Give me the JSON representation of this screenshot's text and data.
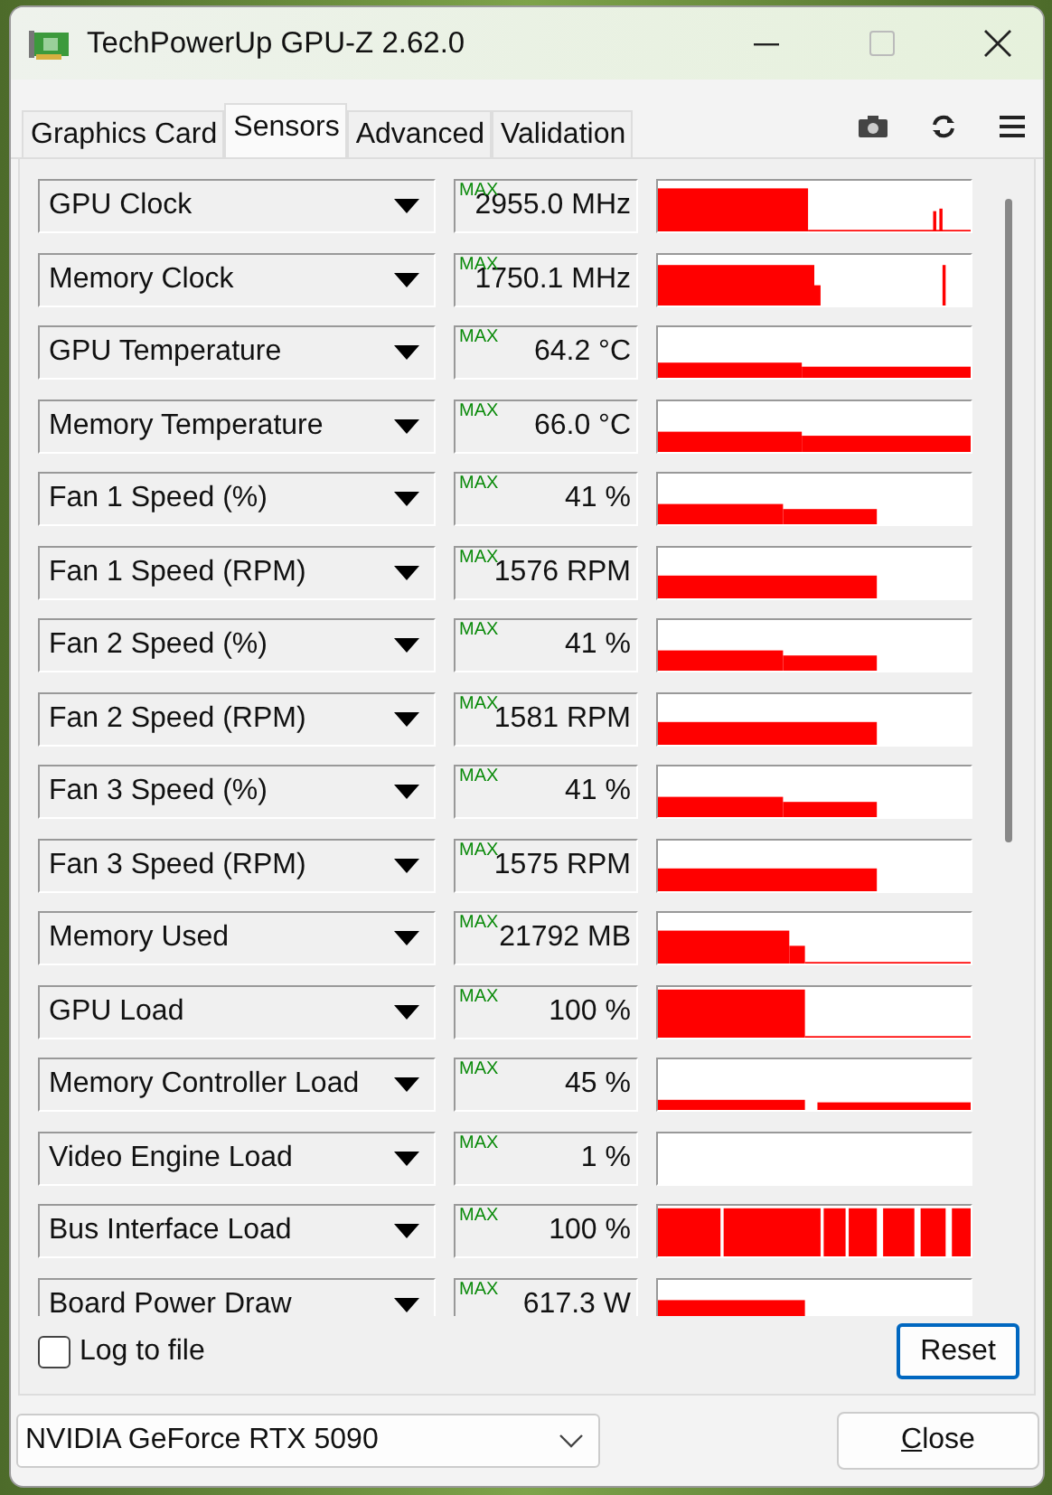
{
  "window": {
    "title": "TechPowerUp GPU-Z 2.62.0"
  },
  "tabs": [
    {
      "label": "Graphics Card",
      "selected": false
    },
    {
      "label": "Sensors",
      "selected": true
    },
    {
      "label": "Advanced",
      "selected": false
    },
    {
      "label": "Validation",
      "selected": false
    }
  ],
  "sensors": [
    {
      "name": "GPU Clock",
      "max_label": "MAX",
      "value": "2955.0 MHz"
    },
    {
      "name": "Memory Clock",
      "max_label": "MAX",
      "value": "1750.1 MHz"
    },
    {
      "name": "GPU Temperature",
      "max_label": "MAX",
      "value": "64.2 °C"
    },
    {
      "name": "Memory Temperature",
      "max_label": "MAX",
      "value": "66.0 °C"
    },
    {
      "name": "Fan 1 Speed (%)",
      "max_label": "MAX",
      "value": "41 %"
    },
    {
      "name": "Fan 1 Speed (RPM)",
      "max_label": "MAX",
      "value": "1576 RPM"
    },
    {
      "name": "Fan 2 Speed (%)",
      "max_label": "MAX",
      "value": "41 %"
    },
    {
      "name": "Fan 2 Speed (RPM)",
      "max_label": "MAX",
      "value": "1581 RPM"
    },
    {
      "name": "Fan 3 Speed (%)",
      "max_label": "MAX",
      "value": "41 %"
    },
    {
      "name": "Fan 3 Speed (RPM)",
      "max_label": "MAX",
      "value": "1575 RPM"
    },
    {
      "name": "Memory Used",
      "max_label": "MAX",
      "value": "21792 MB"
    },
    {
      "name": "GPU Load",
      "max_label": "MAX",
      "value": "100 %"
    },
    {
      "name": "Memory Controller Load",
      "max_label": "MAX",
      "value": "45 %"
    },
    {
      "name": "Video Engine Load",
      "max_label": "MAX",
      "value": "1 %"
    },
    {
      "name": "Bus Interface Load",
      "max_label": "MAX",
      "value": "100 %"
    },
    {
      "name": "Board Power Draw",
      "max_label": "MAX",
      "value": "617.3 W"
    }
  ],
  "log_to_file": {
    "label": "Log to file",
    "checked": false
  },
  "reset_button": "Reset",
  "gpu_select": {
    "value": "NVIDIA GeForce RTX 5090"
  },
  "close_button": "Close"
}
